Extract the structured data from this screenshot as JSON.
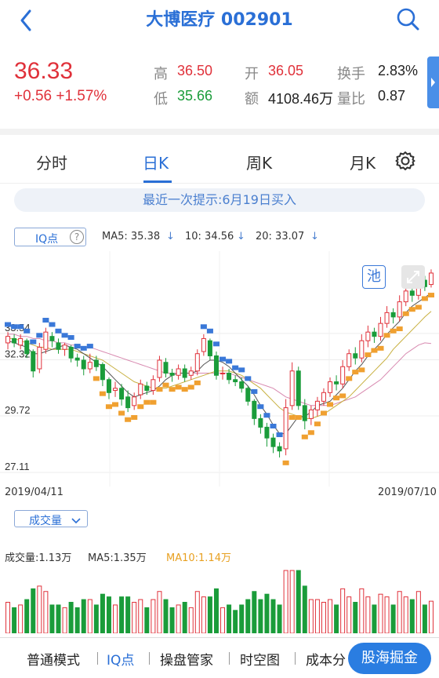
{
  "header": {
    "title": "大博医疗 002901"
  },
  "quote": {
    "price": "36.33",
    "change": "+0.56 +1.57%",
    "high_label": "高",
    "high": "36.50",
    "open_label": "开",
    "open": "36.05",
    "turnover_label": "换手",
    "turnover": "2.83%",
    "low_label": "低",
    "low": "35.66",
    "amount_label": "额",
    "amount": "4108.46万",
    "ratio_label": "量比",
    "ratio": "0.87"
  },
  "tabs": [
    {
      "label": "分时"
    },
    {
      "label": "日K"
    },
    {
      "label": "周K"
    },
    {
      "label": "月K"
    }
  ],
  "hint": "最近一次提示:6月19日买入",
  "indicators": {
    "iq_label": "IQ点",
    "ma5": "MA5: 35.38",
    "ma10": "10: 34.56",
    "ma20": "20: 33.07",
    "pool_label": "池"
  },
  "chart_data": {
    "type": "candlestick",
    "y_ticks": [
      "33.54",
      "32.32",
      "29.72",
      "27.11"
    ],
    "ylim": [
      26.6,
      37.2
    ],
    "x_start": "2019/04/11",
    "x_end": "2019/07/10",
    "candles": [
      [
        33.1,
        33.4,
        32.8,
        33.6
      ],
      [
        33.3,
        33.1,
        32.9,
        33.5
      ],
      [
        33.0,
        33.3,
        32.8,
        33.5
      ],
      [
        33.2,
        32.6,
        32.4,
        33.3
      ],
      [
        32.7,
        31.8,
        31.5,
        32.8
      ],
      [
        31.9,
        32.9,
        31.7,
        33.1
      ],
      [
        32.8,
        33.6,
        32.6,
        33.8
      ],
      [
        33.4,
        33.2,
        32.9,
        33.6
      ],
      [
        33.1,
        32.8,
        32.6,
        33.3
      ],
      [
        32.8,
        33.0,
        32.5,
        33.1
      ],
      [
        32.9,
        32.4,
        32.2,
        33.0
      ],
      [
        32.4,
        32.3,
        32.0,
        32.6
      ],
      [
        32.3,
        31.9,
        31.6,
        32.5
      ],
      [
        31.9,
        32.2,
        31.7,
        32.6
      ],
      [
        32.3,
        32.0,
        31.8,
        32.5
      ],
      [
        32.1,
        31.4,
        31.1,
        32.2
      ],
      [
        31.4,
        30.8,
        30.5,
        31.5
      ],
      [
        30.9,
        31.0,
        30.6,
        31.3
      ],
      [
        31.0,
        30.5,
        30.2,
        31.2
      ],
      [
        30.6,
        30.1,
        29.9,
        30.9
      ],
      [
        30.2,
        30.6,
        30.0,
        30.8
      ],
      [
        30.7,
        31.2,
        30.5,
        31.4
      ],
      [
        31.1,
        30.9,
        30.7,
        31.3
      ],
      [
        30.9,
        31.4,
        30.7,
        31.6
      ],
      [
        31.5,
        32.3,
        31.3,
        32.5
      ],
      [
        32.2,
        31.7,
        31.5,
        32.4
      ],
      [
        31.7,
        31.6,
        31.3,
        31.9
      ],
      [
        31.6,
        31.9,
        31.4,
        32.1
      ],
      [
        31.9,
        31.5,
        31.3,
        32.1
      ],
      [
        31.6,
        31.8,
        31.4,
        32.0
      ],
      [
        31.8,
        32.6,
        31.6,
        32.8
      ],
      [
        32.7,
        33.3,
        32.5,
        33.5
      ],
      [
        33.2,
        32.5,
        32.3,
        33.3
      ],
      [
        32.5,
        31.6,
        31.4,
        32.7
      ],
      [
        31.7,
        31.7,
        31.4,
        32.0
      ],
      [
        31.7,
        31.4,
        31.2,
        31.9
      ],
      [
        31.4,
        31.3,
        31.1,
        31.6
      ],
      [
        31.3,
        31.0,
        30.8,
        31.5
      ],
      [
        31.0,
        30.4,
        30.2,
        31.1
      ],
      [
        30.4,
        29.6,
        29.3,
        30.5
      ],
      [
        29.6,
        29.2,
        28.9,
        29.8
      ],
      [
        29.2,
        28.7,
        28.3,
        29.4
      ],
      [
        28.7,
        28.3,
        28.0,
        28.9
      ],
      [
        28.3,
        28.1,
        27.8,
        28.5
      ],
      [
        28.2,
        30.1,
        27.9,
        30.5
      ],
      [
        30.2,
        31.8,
        30.0,
        32.2
      ],
      [
        31.8,
        30.2,
        30.0,
        32.0
      ],
      [
        30.2,
        29.5,
        29.1,
        30.5
      ],
      [
        29.6,
        30.0,
        29.3,
        30.2
      ],
      [
        30.0,
        30.4,
        29.7,
        30.6
      ],
      [
        30.4,
        30.8,
        30.2,
        31.0
      ],
      [
        30.8,
        31.3,
        30.6,
        31.5
      ],
      [
        31.3,
        31.2,
        30.9,
        31.6
      ],
      [
        31.2,
        32.0,
        31.0,
        32.3
      ],
      [
        32.0,
        32.6,
        31.8,
        32.8
      ],
      [
        32.6,
        32.4,
        32.1,
        32.9
      ],
      [
        32.4,
        33.2,
        32.2,
        33.5
      ],
      [
        33.2,
        33.6,
        32.9,
        33.9
      ],
      [
        33.6,
        33.4,
        33.1,
        33.8
      ],
      [
        33.4,
        34.0,
        33.2,
        34.3
      ],
      [
        34.0,
        34.5,
        33.8,
        34.8
      ],
      [
        34.5,
        34.3,
        34.0,
        34.7
      ],
      [
        34.3,
        35.0,
        34.1,
        35.3
      ],
      [
        35.0,
        35.5,
        34.8,
        35.8
      ],
      [
        35.5,
        35.3,
        35.0,
        35.9
      ],
      [
        35.3,
        36.0,
        35.1,
        36.3
      ],
      [
        36.0,
        35.7,
        35.5,
        36.2
      ],
      [
        35.8,
        36.33,
        35.66,
        36.5
      ]
    ],
    "ma5": [
      33.2,
      33.1,
      33.0,
      32.9,
      32.6,
      32.6,
      32.7,
      32.8,
      32.9,
      33.0,
      32.9,
      32.8,
      32.6,
      32.4,
      32.2,
      32.0,
      31.7,
      31.4,
      31.1,
      30.8,
      30.6,
      30.7,
      30.8,
      30.9,
      31.1,
      31.4,
      31.6,
      31.7,
      31.7,
      31.7,
      31.8,
      32.1,
      32.3,
      32.3,
      32.2,
      32.0,
      31.7,
      31.4,
      31.1,
      30.7,
      30.2,
      29.8,
      29.3,
      28.9,
      28.9,
      29.3,
      29.7,
      29.7,
      29.9,
      30.2,
      30.3,
      30.4,
      30.7,
      31.0,
      31.4,
      31.8,
      32.1,
      32.5,
      32.8,
      33.1,
      33.5,
      33.8,
      34.1,
      34.5,
      34.8,
      35.0,
      35.2,
      35.4
    ],
    "ma10": [
      33.3,
      33.3,
      33.2,
      33.1,
      33.0,
      32.9,
      32.9,
      32.8,
      32.8,
      32.8,
      32.8,
      32.7,
      32.6,
      32.5,
      32.4,
      32.3,
      32.1,
      31.9,
      31.7,
      31.5,
      31.3,
      31.2,
      31.1,
      31.0,
      31.0,
      31.0,
      31.1,
      31.2,
      31.3,
      31.4,
      31.5,
      31.6,
      31.7,
      31.8,
      31.8,
      31.8,
      31.7,
      31.6,
      31.4,
      31.2,
      31.0,
      30.7,
      30.4,
      30.1,
      29.9,
      29.8,
      29.7,
      29.6,
      29.6,
      29.7,
      29.8,
      30.0,
      30.2,
      30.4,
      30.6,
      30.9,
      31.2,
      31.5,
      31.8,
      32.1,
      32.4,
      32.8,
      33.1,
      33.4,
      33.7,
      34.0,
      34.3,
      34.56
    ],
    "ma20": [
      33.5,
      33.5,
      33.4,
      33.4,
      33.3,
      33.3,
      33.2,
      33.2,
      33.1,
      33.1,
      33.0,
      33.0,
      32.9,
      32.9,
      32.8,
      32.7,
      32.6,
      32.5,
      32.4,
      32.3,
      32.2,
      32.1,
      32.0,
      31.9,
      31.8,
      31.7,
      31.7,
      31.7,
      31.7,
      31.7,
      31.7,
      31.7,
      31.7,
      31.7,
      31.7,
      31.7,
      31.6,
      31.5,
      31.4,
      31.3,
      31.2,
      31.1,
      31.0,
      30.8,
      30.6,
      30.5,
      30.4,
      30.3,
      30.2,
      30.2,
      30.2,
      30.2,
      30.3,
      30.4,
      30.5,
      30.6,
      30.8,
      31.0,
      31.2,
      31.4,
      31.7,
      32.0,
      32.3,
      32.6,
      32.8,
      33.0,
      33.1,
      33.07
    ]
  },
  "volume": {
    "chip_label": "成交量",
    "vol_text": "成交量:1.13万",
    "ma5_text": "MA5:1.35万",
    "ma10_text": "MA10:1.14万"
  },
  "bottom_bar": {
    "items": [
      "普通模式",
      "IQ点",
      "操盘管家",
      "时空图",
      "成本分"
    ],
    "cta": "股海掘金"
  },
  "colors": {
    "up": "#e0313a",
    "down": "#1a9c3a",
    "accent": "#2a6fd6",
    "signal_sell": "#3a78d8",
    "signal_buy": "#f0a030"
  }
}
